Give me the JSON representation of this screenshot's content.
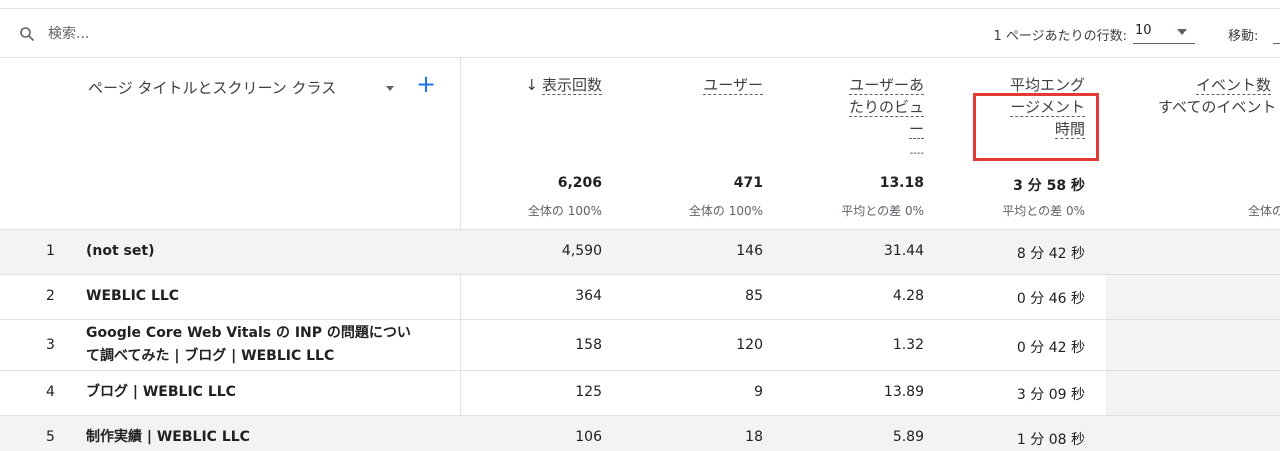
{
  "toolbar": {
    "search_placeholder": "検索...",
    "rows_per_page_label": "1 ページあたりの行数:",
    "rows_per_page_value": "10",
    "goto_label": "移動:"
  },
  "table": {
    "dimension_header": "ページ タイトルとスクリーン クラス",
    "add_dimension": "+",
    "sort_arrow": "↓",
    "metric_headers": [
      [
        "表示回数"
      ],
      [
        "ユーザー"
      ],
      [
        "ユーザーあ",
        "たりのビュ",
        "ー",
        "----"
      ],
      [
        "平均エング",
        "ージメント",
        "時間"
      ],
      [
        "イベント数",
        "すべてのイベント"
      ]
    ],
    "totals": [
      "6,206",
      "471",
      "13.18",
      "3 分 58 秒"
    ],
    "totals_sub": [
      "全体の 100%",
      "全体の 100%",
      "平均との差 0%",
      "平均との差 0%",
      "全体の"
    ],
    "rows": [
      {
        "idx": "1",
        "dim": "(not set)",
        "views": "4,590",
        "users": "146",
        "vpu": "31.44",
        "time": "8 分 42 秒"
      },
      {
        "idx": "2",
        "dim": "WEBLIC LLC",
        "views": "364",
        "users": "85",
        "vpu": "4.28",
        "time": "0 分 46 秒"
      },
      {
        "idx": "3",
        "dim": "Google Core Web Vitals の INP の問題について調べてみた | ブログ | WEBLIC LLC",
        "dim_line1": "Google Core Web Vitals の INP の問題につい",
        "dim_line2": "て調べてみた | ブログ | WEBLIC LLC",
        "views": "158",
        "users": "120",
        "vpu": "1.32",
        "time": "0 分 42 秒"
      },
      {
        "idx": "4",
        "dim": "ブログ | WEBLIC LLC",
        "views": "125",
        "users": "9",
        "vpu": "13.89",
        "time": "3 分 09 秒"
      },
      {
        "idx": "5",
        "dim": "制作実績 | WEBLIC LLC",
        "views": "106",
        "users": "18",
        "vpu": "5.89",
        "time": "1 分 08 秒"
      }
    ]
  },
  "colors": {
    "accent": "#1a73e8",
    "highlight": "#e53935",
    "shade": "#f1f3f4"
  }
}
